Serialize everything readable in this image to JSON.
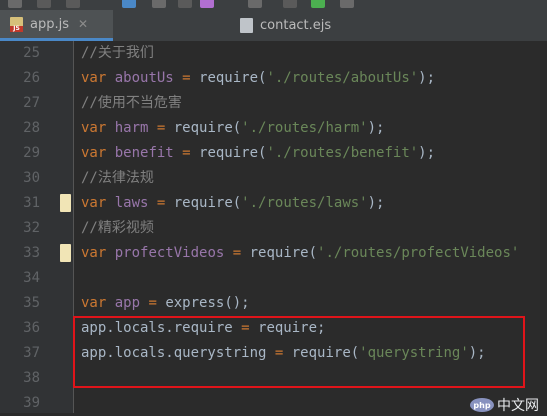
{
  "tabs": [
    {
      "label": "app.js",
      "badge": "JS",
      "active": true
    },
    {
      "label": "contact.ejs",
      "badge": "",
      "active": false
    }
  ],
  "code_lines": [
    {
      "num": "25",
      "tokens": [
        {
          "t": "//关于我们",
          "c": "comment"
        }
      ]
    },
    {
      "num": "26",
      "tokens": [
        {
          "t": "var",
          "c": "kw"
        },
        {
          "t": " aboutUs ",
          "c": "var"
        },
        {
          "t": "=",
          "c": "dot"
        },
        {
          "t": " require(",
          "c": "plain"
        },
        {
          "t": "'./routes/aboutUs'",
          "c": "str"
        },
        {
          "t": ");",
          "c": "plain"
        }
      ]
    },
    {
      "num": "27",
      "tokens": [
        {
          "t": "//使用不当危害",
          "c": "comment"
        }
      ]
    },
    {
      "num": "28",
      "tokens": [
        {
          "t": "var",
          "c": "kw"
        },
        {
          "t": " harm ",
          "c": "var"
        },
        {
          "t": "=",
          "c": "dot"
        },
        {
          "t": " require(",
          "c": "plain"
        },
        {
          "t": "'./routes/harm'",
          "c": "str"
        },
        {
          "t": ");",
          "c": "plain"
        }
      ]
    },
    {
      "num": "29",
      "tokens": [
        {
          "t": "var",
          "c": "kw"
        },
        {
          "t": " benefit ",
          "c": "var"
        },
        {
          "t": "=",
          "c": "dot"
        },
        {
          "t": " require(",
          "c": "plain"
        },
        {
          "t": "'./routes/benefit'",
          "c": "str"
        },
        {
          "t": ");",
          "c": "plain"
        }
      ]
    },
    {
      "num": "30",
      "tokens": [
        {
          "t": "//法律法规",
          "c": "comment"
        }
      ]
    },
    {
      "num": "31",
      "tokens": [
        {
          "t": "var",
          "c": "kw"
        },
        {
          "t": " laws ",
          "c": "var"
        },
        {
          "t": "=",
          "c": "dot"
        },
        {
          "t": " require(",
          "c": "plain"
        },
        {
          "t": "'./routes/laws'",
          "c": "str"
        },
        {
          "t": ");",
          "c": "plain"
        }
      ],
      "marker": true
    },
    {
      "num": "32",
      "tokens": [
        {
          "t": "//精彩视频",
          "c": "comment"
        }
      ]
    },
    {
      "num": "33",
      "tokens": [
        {
          "t": "var",
          "c": "kw"
        },
        {
          "t": " profectVideos ",
          "c": "var"
        },
        {
          "t": "=",
          "c": "dot"
        },
        {
          "t": " require(",
          "c": "plain"
        },
        {
          "t": "'./routes/profectVideos'",
          "c": "str"
        }
      ],
      "marker": true
    },
    {
      "num": "34",
      "tokens": []
    },
    {
      "num": "35",
      "tokens": [
        {
          "t": "var",
          "c": "kw"
        },
        {
          "t": " app ",
          "c": "var"
        },
        {
          "t": "=",
          "c": "dot"
        },
        {
          "t": " express();",
          "c": "plain"
        }
      ]
    },
    {
      "num": "36",
      "tokens": [
        {
          "t": "app.locals.require ",
          "c": "plain"
        },
        {
          "t": "=",
          "c": "dot"
        },
        {
          "t": " require;",
          "c": "plain"
        }
      ]
    },
    {
      "num": "37",
      "tokens": [
        {
          "t": "app.locals.querystring ",
          "c": "plain"
        },
        {
          "t": "=",
          "c": "dot"
        },
        {
          "t": " require(",
          "c": "plain"
        },
        {
          "t": "'querystring'",
          "c": "str"
        },
        {
          "t": ");",
          "c": "plain"
        }
      ]
    },
    {
      "num": "38",
      "tokens": []
    },
    {
      "num": "39",
      "tokens": []
    }
  ],
  "watermark": {
    "logo": "php",
    "text": "中文网"
  },
  "colors": {
    "comment": "#808080",
    "keyword": "#cc7832",
    "variable": "#9876aa",
    "string": "#6a8759",
    "plain": "#a9b7c6",
    "highlight_border": "#e0141a"
  }
}
